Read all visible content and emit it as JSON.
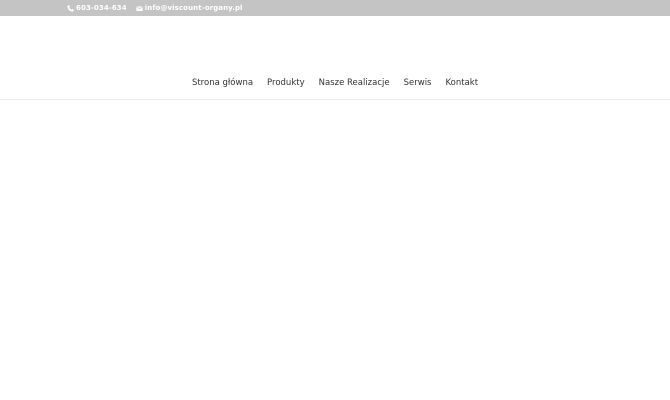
{
  "topbar": {
    "background": "#c4c4c4",
    "phone": {
      "icon": "phone-icon",
      "text": "603-034-634"
    },
    "email": {
      "icon": "envelope-icon",
      "text": "info@viscount-organy.pl"
    }
  },
  "nav": {
    "items": [
      {
        "label": "Strona główna"
      },
      {
        "label": "Produkty"
      },
      {
        "label": "Nasze Realizacje"
      },
      {
        "label": "Serwis"
      },
      {
        "label": "Kontakt"
      }
    ]
  }
}
